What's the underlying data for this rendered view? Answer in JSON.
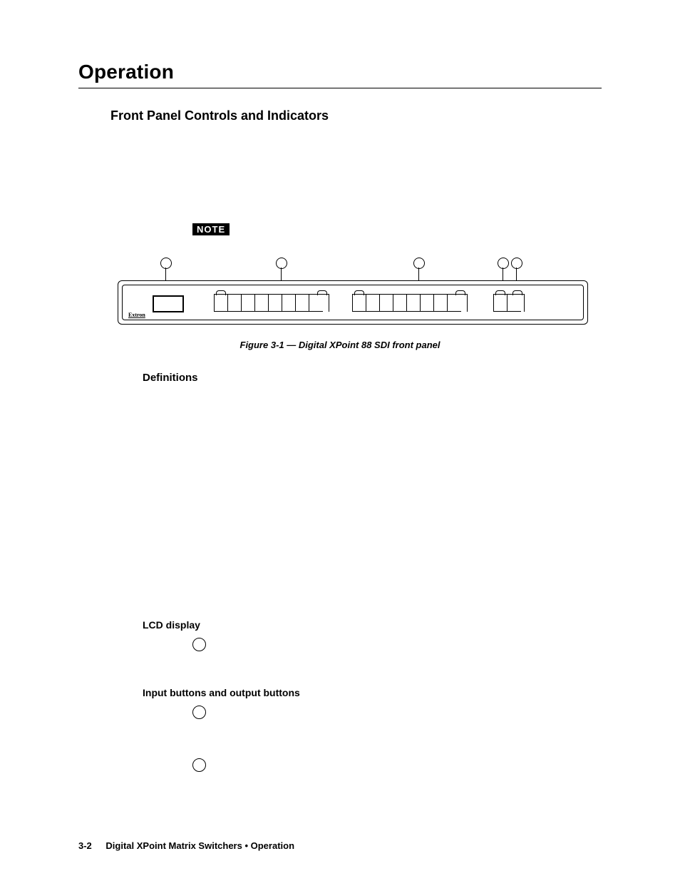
{
  "header": {
    "chapter_title": "Operation"
  },
  "section": {
    "title": "Front Panel Controls and Indicators"
  },
  "note": {
    "label": "NOTE"
  },
  "figure": {
    "brand": "Extron",
    "caption": "Figure 3-1 — Digital XPoint 88 SDI front panel"
  },
  "definitions": {
    "heading": "Definitions",
    "lcd_heading": "LCD display",
    "io_heading": "Input buttons and output buttons"
  },
  "footer": {
    "page_number": "3-2",
    "title": "Digital XPoint Matrix Switchers • Operation"
  }
}
